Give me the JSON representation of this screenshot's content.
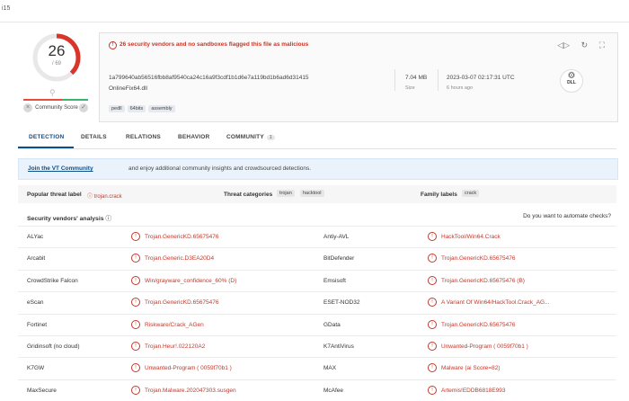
{
  "topbar": {
    "crumb": "i15"
  },
  "score": {
    "detected": "26",
    "total": "/ 69",
    "community_label": "Community Score",
    "x_sym": "×",
    "check_sym": "✓"
  },
  "alert": {
    "text": "26 security vendors and no sandboxes flagged this file as malicious"
  },
  "file": {
    "hash": "1a799640ab56516fbb8af9540ca24c16a9f3cdf1b1d6e7a119bd1b6ad6d31415",
    "name": "OnlineFix64.dll",
    "tags": [
      "pedll",
      "64bits",
      "assembly"
    ],
    "size": "7.04 MB",
    "size_label": "Size",
    "date": "2023-03-07 02:17:31 UTC",
    "age": "6 hours ago",
    "type": "DLL"
  },
  "tabs": {
    "detection": "DETECTION",
    "details": "DETAILS",
    "relations": "RELATIONS",
    "behavior": "BEHAVIOR",
    "community": "COMMUNITY",
    "community_count": "1"
  },
  "banner": {
    "link": "Join the VT Community",
    "rest": "and enjoy additional community insights and crowdsourced detections."
  },
  "threat": {
    "popular_label": "Popular threat label",
    "popular_value": "trojan.crack",
    "categories_label": "Threat categories",
    "categories": [
      "trojan",
      "hacktool"
    ],
    "family_label": "Family labels",
    "family": [
      "crack"
    ]
  },
  "vendors_title": "Security vendors' analysis",
  "automate": "Do you want to automate checks?",
  "vendors": [
    {
      "v1": "ALYac",
      "r1": "Trojan.GenericKD.65675476",
      "v2": "Antiy-AVL",
      "r2": "HackTool/Win64.Crack"
    },
    {
      "v1": "Arcabit",
      "r1": "Trojan.Generic.D3EA20D4",
      "v2": "BitDefender",
      "r2": "Trojan.GenericKD.65675476"
    },
    {
      "v1": "CrowdStrike Falcon",
      "r1": "Win/grayware_confidence_60% (D)",
      "v2": "Emsisoft",
      "r2": "Trojan.GenericKD.65675476 (B)"
    },
    {
      "v1": "eScan",
      "r1": "Trojan.GenericKD.65675476",
      "v2": "ESET-NOD32",
      "r2": "A Variant Of Win64/HackTool.Crack_AG..."
    },
    {
      "v1": "Fortinet",
      "r1": "Riskware/Crack_AGen",
      "v2": "GData",
      "r2": "Trojan.GenericKD.65675476"
    },
    {
      "v1": "Gridinsoft (no cloud)",
      "r1": "Trojan.Heur!.022120A2",
      "v2": "K7AntiVirus",
      "r2": "Unwanted-Program ( 0059f70b1 )"
    },
    {
      "v1": "K7GW",
      "r1": "Unwanted-Program ( 0059f70b1 )",
      "v2": "MAX",
      "r2": "Malware (ai Score=82)"
    },
    {
      "v1": "MaxSecure",
      "r1": "Trojan.Malware.202047303.susgen",
      "v2": "McAfee",
      "r2": "Artemis!EDDB6818E993"
    }
  ]
}
